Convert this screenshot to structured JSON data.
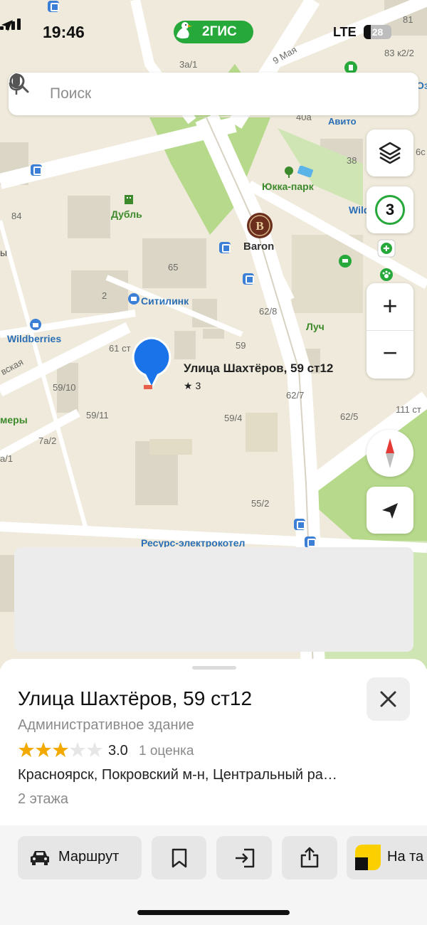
{
  "status_bar": {
    "time": "19:46",
    "brand": "2ГИС",
    "network": "LTE",
    "battery": "28"
  },
  "search": {
    "placeholder": "Поиск"
  },
  "map": {
    "traffic_level": "3",
    "zoom_in": "+",
    "zoom_out": "−",
    "labels": {
      "street_9maya": "9 Мая",
      "house_3a1": "3а/1",
      "house_81": "81",
      "house_83k2": "83 к2/2",
      "oz": "Оз",
      "avito": "Авито",
      "house_40a": "40а",
      "house_38": "38",
      "house_6": "6с",
      "yukka_park": "Юкка-парк",
      "wild_right": "Wild",
      "dubl": "Дубль",
      "house_84": "84",
      "baron": "Baron",
      "house_65": "65",
      "ы": "ы",
      "house_2": "2",
      "citilink": "Ситилинк",
      "house_62_8": "62/8",
      "luch": "Луч",
      "wildberries": "Wildberries",
      "house_61": "61 ст",
      "house_59": "59",
      "street_vskaya": "вская",
      "house_59_10": "59/10",
      "house_62_7": "62/7",
      "house_62_5": "62/5",
      "house_111": "111 ст",
      "house_59_11": "59/11",
      "house_59_4": "59/4",
      "mery": "меры",
      "house_7a2": "7а/2",
      "house_a1": "а/1",
      "house_55_2": "55/2",
      "resurs": "Ресурс-электрокотел",
      "selected_place": "Улица Шахтёров, 59 ст12",
      "selected_rating": "★ 3"
    }
  },
  "place": {
    "title": "Улица Шахтёров, 59 ст12",
    "type": "Административное здание",
    "rating_value": "3.0",
    "rating_stars": 3,
    "rating_max": 5,
    "rating_count": "1 оценка",
    "address": "Красноярск, Покровский м-н, Центральный ра…",
    "floors": "2 этажа"
  },
  "actions": {
    "route": "Маршрут",
    "taxi": "На та"
  },
  "colors": {
    "brand_green": "#27a83b",
    "pin_blue": "#1a73e8",
    "star_gold": "#f2a900",
    "compass_red": "#e53935"
  }
}
